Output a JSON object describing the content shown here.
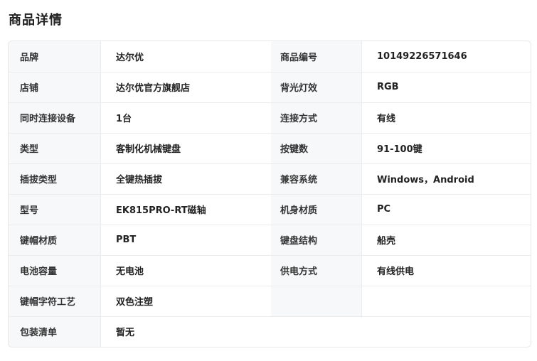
{
  "page": {
    "title": "商品详情"
  },
  "specs": {
    "rows": [
      {
        "label1": "品牌",
        "value1": "达尔优",
        "label2": "商品编号",
        "value2": "10149226571646"
      },
      {
        "label1": "店铺",
        "value1": "达尔优官方旗舰店",
        "label2": "背光灯效",
        "value2": "RGB"
      },
      {
        "label1": "同时连接设备",
        "value1": "1台",
        "label2": "连接方式",
        "value2": "有线"
      },
      {
        "label1": "类型",
        "value1": "客制化机械键盘",
        "label2": "按键数",
        "value2": "91-100键"
      },
      {
        "label1": "插拔类型",
        "value1": "全键热插拔",
        "label2": "兼容系统",
        "value2": "Windows，Android"
      },
      {
        "label1": "型号",
        "value1": "EK815PRO-RT磁轴",
        "label2": "机身材质",
        "value2": "PC"
      },
      {
        "label1": "键帽材质",
        "value1": "PBT",
        "label2": "键盘结构",
        "value2": "船壳"
      },
      {
        "label1": "电池容量",
        "value1": "无电池",
        "label2": "供电方式",
        "value2": "有线供电"
      },
      {
        "label1": "键帽字符工艺",
        "value1": "双色注塑",
        "label2": "",
        "value2": ""
      }
    ],
    "last_row": {
      "label": "包装清单",
      "value": "暂无"
    }
  }
}
